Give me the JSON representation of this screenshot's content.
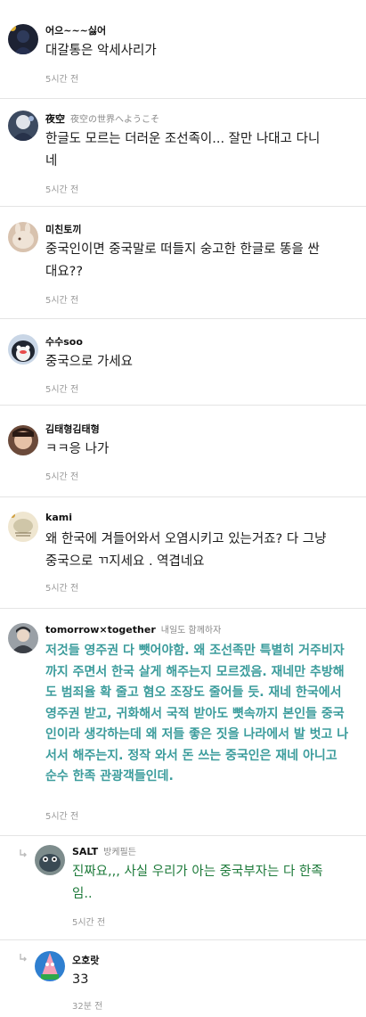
{
  "comments": [
    {
      "author": "어으~~~싫어",
      "tagline": "",
      "text": "대갈통은 악세사리가",
      "time": "5시간 전"
    },
    {
      "author": "夜空",
      "tagline": "夜空の世界へようこそ",
      "text": "한글도 모르는 더러운 조선족이... 잘만 나대고 다니\n네",
      "time": "5시간 전"
    },
    {
      "author": "미친토끼",
      "tagline": "",
      "text": "중국인이면 중국말로 떠들지 숭고한 한글로 똥을 싼\n대요??",
      "time": "5시간 전"
    },
    {
      "author": "수수soo",
      "tagline": "",
      "text": "중국으로 가세요",
      "time": "5시간 전"
    },
    {
      "author": "김태형김태형",
      "tagline": "",
      "text": "ㅋㅋ응 나가",
      "time": "5시간 전"
    },
    {
      "author": "kami",
      "tagline": "",
      "text": "왜 한국에 겨들어와서 오염시키고 있는거죠? 다 그냥\n중국으로 ㄲ지세요 . 역겹네요",
      "time": "5시간 전"
    },
    {
      "author": "tomorrow×together",
      "tagline": "내일도 함께하자",
      "text": "저것들 영주권 다 뺏어야함. 왜 조선족만 특별히 거주비자\n까지 주면서 한국 살게 해주는지 모르겠음. 재네만 추방해\n도 범죄율 확 줄고 혐오 조장도 줄어들 듯. 재네 한국에서\n영주권 받고, 귀화해서 국적 받아도 뼛속까지 본인들 중국\n인이라 생각하는데 왜 저들 좋은 짓을 나라에서 발 벗고 나\n서서 해주는지. 정작 와서 돈 쓰는 중국인은 재네 아니고\n순수 한족 관광객들인데.",
      "time": "5시간 전"
    }
  ],
  "replies": [
    {
      "author": "SALT",
      "tagline": "방케필든",
      "text": "진짜요,,, 사실 우리가 아는 중국부자는 다 한족\n임..",
      "time": "5시간 전"
    },
    {
      "author": "오호랏",
      "tagline": "",
      "text": "33",
      "time": "32분 전"
    }
  ]
}
